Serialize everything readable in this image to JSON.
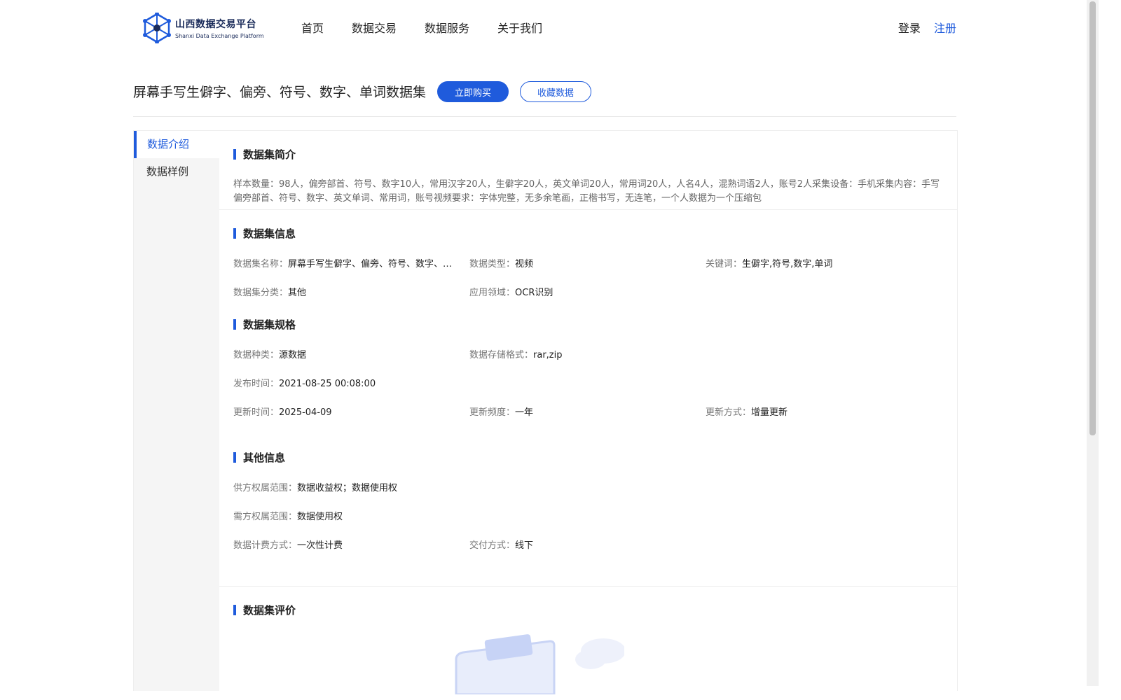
{
  "header": {
    "logo_cn": "山西数据交易平台",
    "logo_en": "Shanxi Data Exchange Platform",
    "nav": [
      "首页",
      "数据交易",
      "数据服务",
      "关于我们"
    ],
    "login": "登录",
    "register": "注册"
  },
  "dataset": {
    "title": "屏幕手写生僻字、偏旁、符号、数字、单词数据集",
    "buy_label": "立即购买",
    "fav_label": "收藏数据"
  },
  "sidebar": [
    "数据介绍",
    "数据样例"
  ],
  "intro": {
    "title": "数据集简介",
    "text": "样本数量：98人，偏旁部首、符号、数字10人，常用汉字20人，生僻字20人，英文单词20人，常用词20人，人名4人，混熟词语2人，账号2人采集设备：手机采集内容：手写偏旁部首、符号、数字、英文单词、常用词，账号视频要求：字体完整，无多余笔画，正楷书写，无连笔，一个人数据为一个压缩包"
  },
  "info": {
    "title": "数据集信息",
    "name_k": "数据集名称：",
    "name_v": "屏幕手写生僻字、偏旁、符号、数字、单词数据集",
    "type_k": "数据类型：",
    "type_v": "视频",
    "kw_k": "关键词：",
    "kw_v": "生僻字,符号,数字,单词",
    "cat_k": "数据集分类：",
    "cat_v": "其他",
    "domain_k": "应用领域：",
    "domain_v": "OCR识别"
  },
  "spec": {
    "title": "数据集规格",
    "kind_k": "数据种类：",
    "kind_v": "源数据",
    "fmt_k": "数据存储格式：",
    "fmt_v": "rar,zip",
    "pub_k": "发布时间：",
    "pub_v": "2021-08-25 00:08:00",
    "upd_k": "更新时间：",
    "upd_v": "2025-04-09",
    "freq_k": "更新频度：",
    "freq_v": "一年",
    "mode_k": "更新方式：",
    "mode_v": "增量更新"
  },
  "other": {
    "title": "其他信息",
    "supply_k": "供方权属范围：",
    "supply_v": "数据收益权；数据使用权",
    "demand_k": "需方权属范围：",
    "demand_v": "数据使用权",
    "bill_k": "数据计费方式：",
    "bill_v": "一次性计费",
    "deliver_k": "交付方式：",
    "deliver_v": "线下"
  },
  "review": {
    "title": "数据集评价"
  },
  "colors": {
    "accent": "#1f5bdc"
  }
}
